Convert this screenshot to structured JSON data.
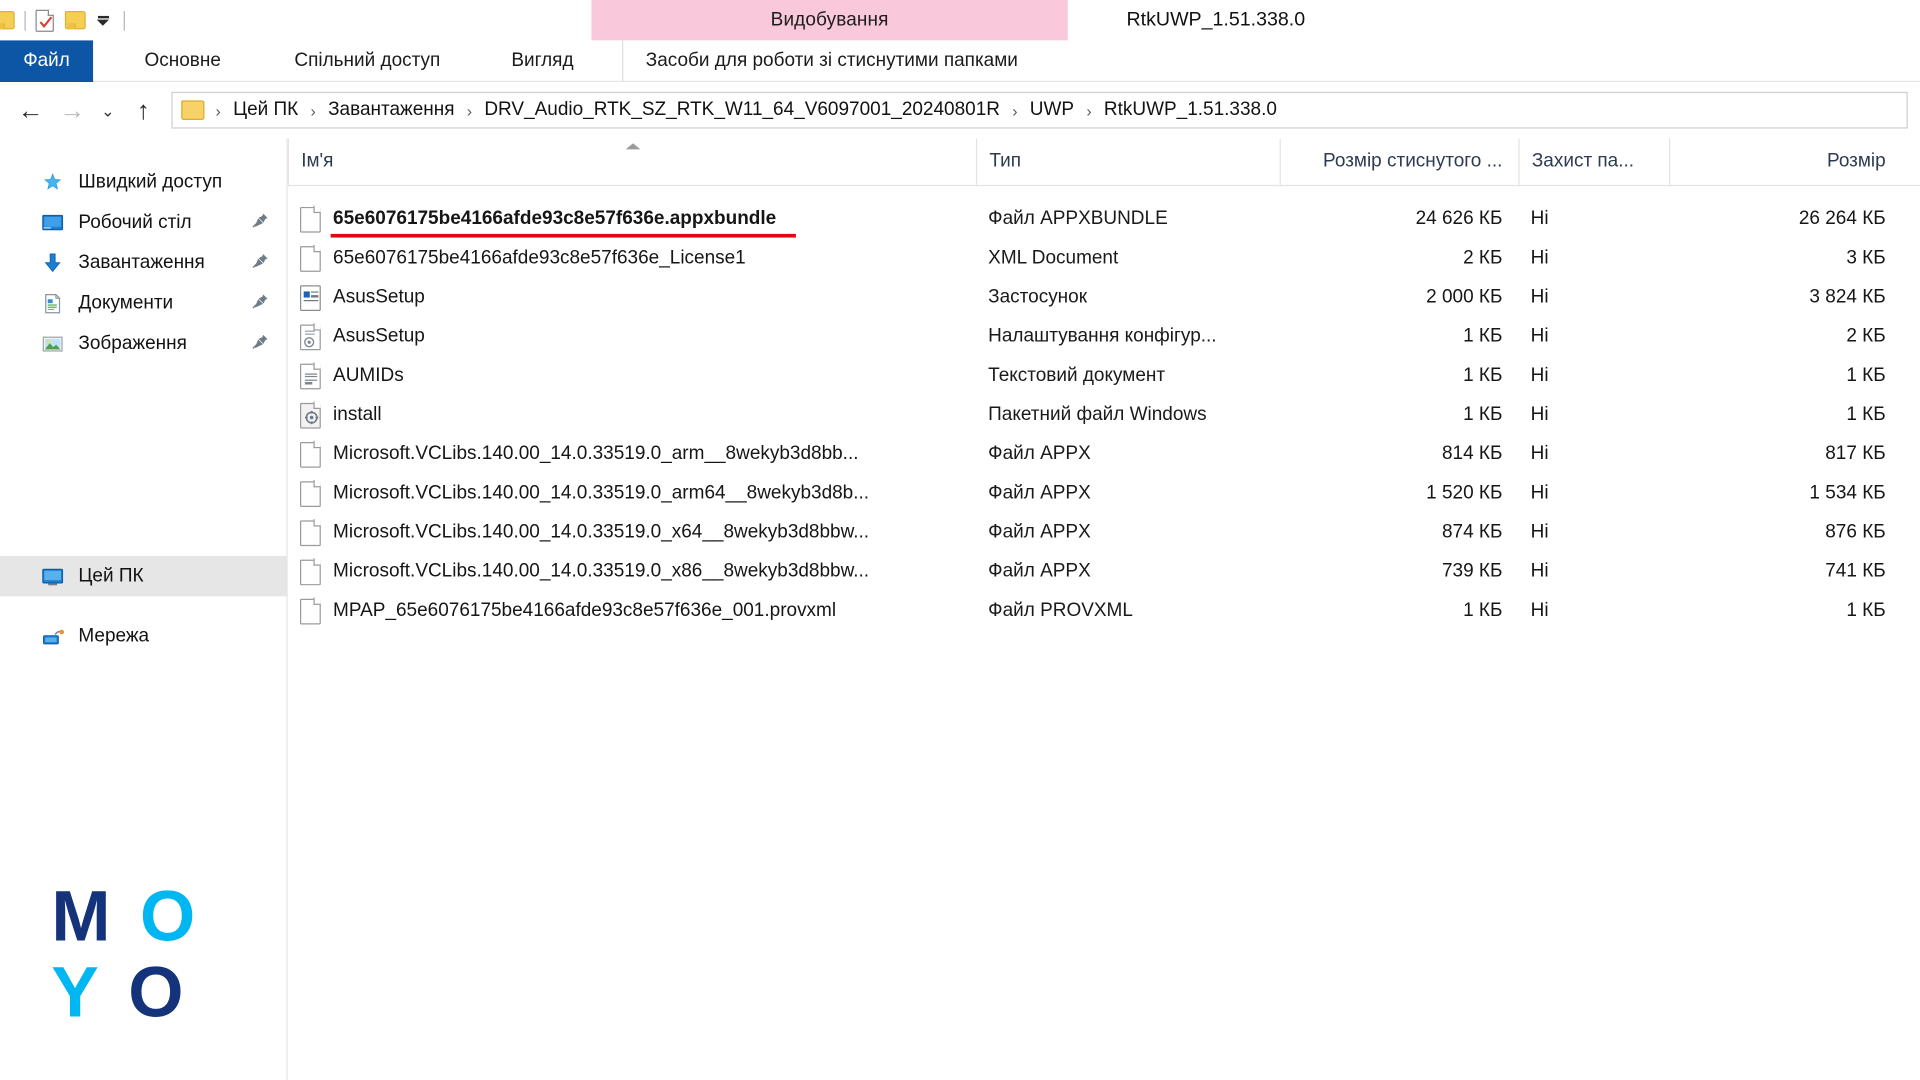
{
  "window": {
    "title": "RtkUWP_1.51.338.0",
    "contextual_tab_group": "Видобування"
  },
  "quick_access_toolbar": {
    "items": [
      {
        "name": "folder-icon",
        "label": ""
      },
      {
        "name": "properties-icon",
        "label": ""
      },
      {
        "name": "new-folder-icon",
        "label": ""
      },
      {
        "name": "customize-dropdown",
        "label": ""
      }
    ]
  },
  "ribbon": {
    "tabs": [
      {
        "label": "Файл",
        "active": true
      },
      {
        "label": "Основне",
        "active": false
      },
      {
        "label": "Спільний доступ",
        "active": false
      },
      {
        "label": "Вигляд",
        "active": false
      },
      {
        "label": "Засоби для роботи зі стиснутими папками",
        "active": false
      }
    ]
  },
  "address_bar": {
    "back_label": "←",
    "forward_label": "→",
    "recent_label": "⌄",
    "up_label": "↑",
    "breadcrumbs": [
      "Цей ПК",
      "Завантаження",
      "DRV_Audio_RTK_SZ_RTK_W11_64_V6097001_20240801R",
      "UWP",
      "RtkUWP_1.51.338.0"
    ],
    "separator": "›"
  },
  "navigation_pane": {
    "items": [
      {
        "label": "Швидкий доступ",
        "icon": "star-pin-icon",
        "pinned": false,
        "selected": false
      },
      {
        "label": "Робочий стіл",
        "icon": "desktop-icon",
        "pinned": true,
        "selected": false
      },
      {
        "label": "Завантаження",
        "icon": "downloads-icon",
        "pinned": true,
        "selected": false
      },
      {
        "label": "Документи",
        "icon": "documents-icon",
        "pinned": true,
        "selected": false
      },
      {
        "label": "Зображення",
        "icon": "pictures-icon",
        "pinned": true,
        "selected": false
      },
      {
        "label": "Цей ПК",
        "icon": "this-pc-icon",
        "pinned": false,
        "selected": true
      },
      {
        "label": "Мережа",
        "icon": "network-icon",
        "pinned": false,
        "selected": false
      }
    ],
    "pin_glyph": "📌"
  },
  "file_list": {
    "columns": [
      {
        "key": "name",
        "label": "Ім'я",
        "sorted": true
      },
      {
        "key": "type",
        "label": "Тип",
        "sorted": false
      },
      {
        "key": "csize",
        "label": "Розмір стиснутого ...",
        "sorted": false
      },
      {
        "key": "prot",
        "label": "Захист па...",
        "sorted": false
      },
      {
        "key": "size",
        "label": "Розмір",
        "sorted": false
      }
    ],
    "rows": [
      {
        "name": "65e6076175be4166afde93c8e57f636e.appxbundle",
        "icon": "blank-file-icon",
        "type": "Файл APPXBUNDLE",
        "csize": "24 626 КБ",
        "prot": "Ні",
        "size": "26 264 КБ",
        "highlighted": true
      },
      {
        "name": "65e6076175be4166afde93c8e57f636e_License1",
        "icon": "blank-file-icon",
        "type": "XML Document",
        "csize": "2 КБ",
        "prot": "Ні",
        "size": "3 КБ",
        "highlighted": false
      },
      {
        "name": "AsusSetup",
        "icon": "application-icon",
        "type": "Застосунок",
        "csize": "2 000 КБ",
        "prot": "Ні",
        "size": "3 824 КБ",
        "highlighted": false
      },
      {
        "name": "AsusSetup",
        "icon": "config-settings-icon",
        "type": "Налаштування конфігур...",
        "csize": "1 КБ",
        "prot": "Ні",
        "size": "2 КБ",
        "highlighted": false
      },
      {
        "name": "AUMIDs",
        "icon": "text-document-icon",
        "type": "Текстовий документ",
        "csize": "1 КБ",
        "prot": "Ні",
        "size": "1 КБ",
        "highlighted": false
      },
      {
        "name": "install",
        "icon": "batch-file-icon",
        "type": "Пакетний файл Windows",
        "csize": "1 КБ",
        "prot": "Ні",
        "size": "1 КБ",
        "highlighted": false
      },
      {
        "name": "Microsoft.VCLibs.140.00_14.0.33519.0_arm__8wekyb3d8bb...",
        "icon": "blank-file-icon",
        "type": "Файл APPX",
        "csize": "814 КБ",
        "prot": "Ні",
        "size": "817 КБ",
        "highlighted": false
      },
      {
        "name": "Microsoft.VCLibs.140.00_14.0.33519.0_arm64__8wekyb3d8b...",
        "icon": "blank-file-icon",
        "type": "Файл APPX",
        "csize": "1 520 КБ",
        "prot": "Ні",
        "size": "1 534 КБ",
        "highlighted": false
      },
      {
        "name": "Microsoft.VCLibs.140.00_14.0.33519.0_x64__8wekyb3d8bbw...",
        "icon": "blank-file-icon",
        "type": "Файл APPX",
        "csize": "874 КБ",
        "prot": "Ні",
        "size": "876 КБ",
        "highlighted": false
      },
      {
        "name": "Microsoft.VCLibs.140.00_14.0.33519.0_x86__8wekyb3d8bbw...",
        "icon": "blank-file-icon",
        "type": "Файл APPX",
        "csize": "739 КБ",
        "prot": "Ні",
        "size": "741 КБ",
        "highlighted": false
      },
      {
        "name": "MPAP_65e6076175be4166afde93c8e57f636e_001.provxml",
        "icon": "blank-file-icon",
        "type": "Файл PROVXML",
        "csize": "1 КБ",
        "prot": "Ні",
        "size": "1 КБ",
        "highlighted": false
      }
    ]
  },
  "watermark": {
    "letters": [
      "M",
      "O",
      "Y",
      "O"
    ]
  },
  "colors": {
    "accent_blue": "#0d55a5",
    "contextual_pink": "#f9c8da",
    "annotation_red": "#e30613",
    "watermark_dark": "#14337a",
    "watermark_cyan": "#00b7f1",
    "selection_gray": "#e6e6e6"
  }
}
